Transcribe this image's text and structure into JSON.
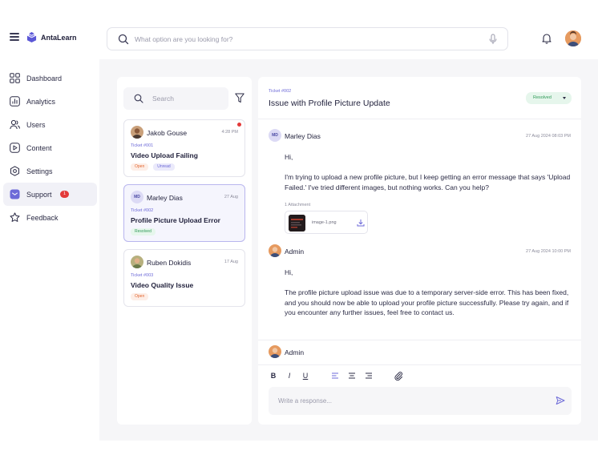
{
  "header": {
    "brand": "AntaLearn",
    "search_placeholder": "What option are you looking for?"
  },
  "sidebar": {
    "items": [
      {
        "label": "Dashboard",
        "icon": "grid-icon"
      },
      {
        "label": "Analytics",
        "icon": "analytics-icon"
      },
      {
        "label": "Users",
        "icon": "users-icon"
      },
      {
        "label": "Content",
        "icon": "play-icon"
      },
      {
        "label": "Settings",
        "icon": "gear-icon"
      },
      {
        "label": "Support",
        "icon": "mail-icon",
        "badge": "1",
        "active": true
      },
      {
        "label": "Feedback",
        "icon": "star-icon"
      }
    ]
  },
  "tickets_panel": {
    "search_placeholder": "Search",
    "tickets": [
      {
        "name": "Jakob Gouse",
        "time": "4:28 PM",
        "id": "Ticket #001",
        "subject": "Video Upload Failing",
        "tags": [
          "Open",
          "Unread"
        ],
        "unread_dot": true
      },
      {
        "name": "Marley Dias",
        "initials": "MD",
        "time": "27 Aug",
        "id": "Ticket #002",
        "subject": "Profile Picture Upload Error",
        "tags": [
          "Resolved"
        ],
        "selected": true
      },
      {
        "name": "Ruben Dokidis",
        "time": "17 Aug",
        "id": "Ticket #003",
        "subject": "Video Quality Issue",
        "tags": [
          "Open"
        ]
      }
    ]
  },
  "conversation": {
    "ticket_id": "Ticket #002",
    "title": "Issue with Profile Picture Update",
    "status": "Resolved",
    "messages": [
      {
        "author": "Marley Dias",
        "initials": "MD",
        "time": "27 Aug 2024 08:03 PM",
        "greeting": "Hi,",
        "body": "I'm trying to upload a new profile picture, but I keep getting an error message that says 'Upload Failed.' I've tried different images, but nothing works. Can you help?",
        "attachment_label": "1 Attachment",
        "attachment_name": "image-1.png"
      },
      {
        "author": "Admin",
        "time": "27 Aug 2024 10:00 PM",
        "greeting": "Hi,",
        "body": "The profile picture upload issue was due to a temporary server-side error. This has been fixed, and you should now be able to upload your profile picture successfully. Please try again, and if you encounter any further issues, feel free to contact us."
      }
    ],
    "composer": {
      "author": "Admin",
      "toolbar": {
        "bold": "B",
        "italic": "I",
        "underline": "U"
      },
      "placeholder": "Write a response..."
    }
  },
  "colors": {
    "accent": "#6d6ad8",
    "resolved": "#2f9a57",
    "open": "#e2662f",
    "badge": "#e33a3a"
  }
}
